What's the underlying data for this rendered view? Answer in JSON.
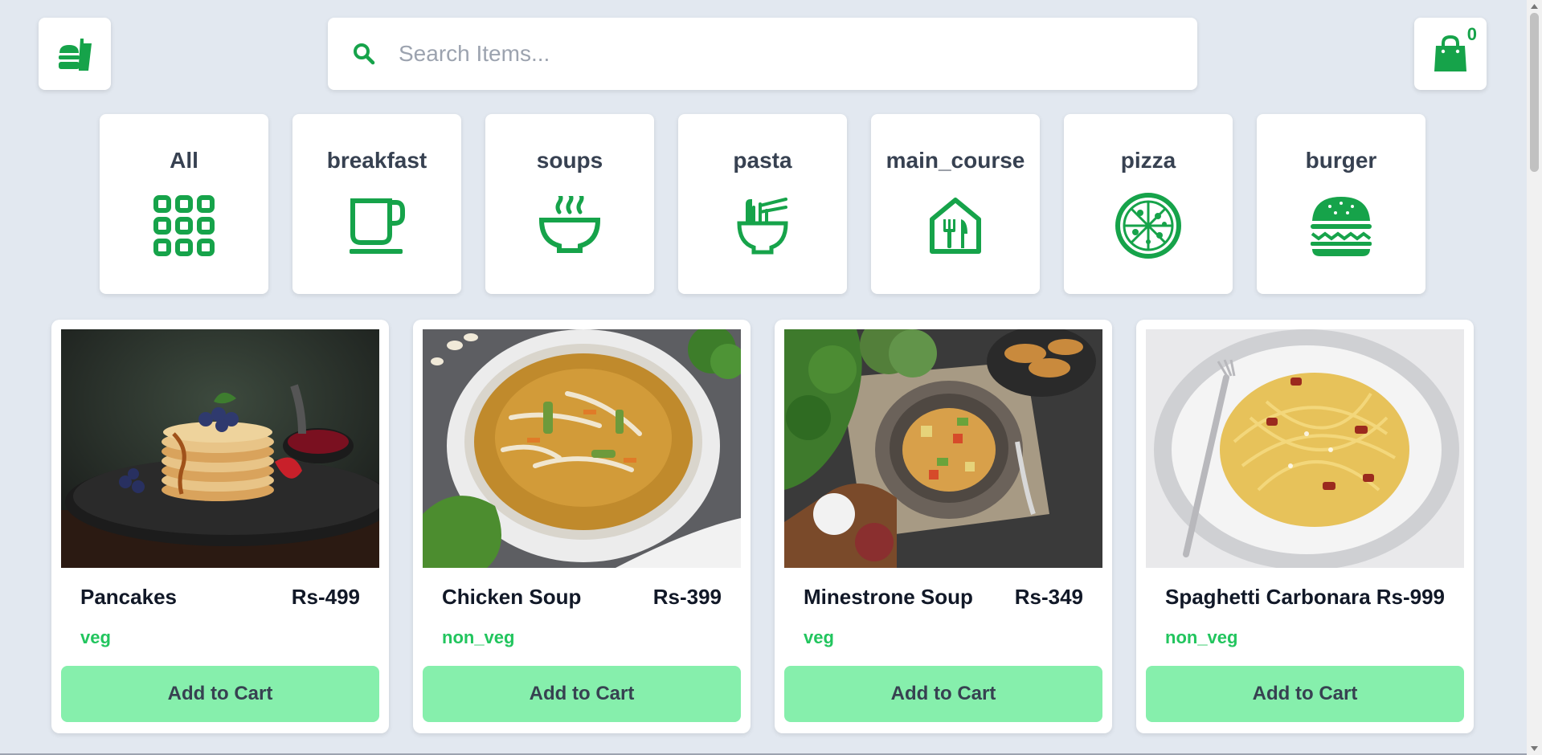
{
  "header": {
    "logo_icon": "fast-food-icon",
    "search": {
      "placeholder": "Search Items...",
      "value": "",
      "icon": "search-icon"
    },
    "cart": {
      "icon": "shopping-bag-icon",
      "count": "0"
    }
  },
  "categories": [
    {
      "label": "All",
      "icon": "grid-icon"
    },
    {
      "label": "breakfast",
      "icon": "coffee-cup-icon"
    },
    {
      "label": "soups",
      "icon": "soup-bowl-icon"
    },
    {
      "label": "pasta",
      "icon": "noodles-icon"
    },
    {
      "label": "main_course",
      "icon": "restaurant-icon"
    },
    {
      "label": "pizza",
      "icon": "pizza-icon"
    },
    {
      "label": "burger",
      "icon": "burger-icon"
    }
  ],
  "products": [
    {
      "name": "Pancakes",
      "price": "Rs-499",
      "type": "veg",
      "button": "Add to Cart",
      "image": "pancakes-photo"
    },
    {
      "name": "Chicken Soup",
      "price": "Rs-399",
      "type": "non_veg",
      "button": "Add to Cart",
      "image": "chicken-soup-photo"
    },
    {
      "name": "Minestrone Soup",
      "price": "Rs-349",
      "type": "veg",
      "button": "Add to Cart",
      "image": "minestrone-soup-photo"
    },
    {
      "name": "Spaghetti Carbonara",
      "price": "Rs-999",
      "type": "non_veg",
      "button": "Add to Cart",
      "image": "spaghetti-photo"
    }
  ],
  "colors": {
    "background": "#e2e8f0",
    "accent": "#16a34a",
    "button": "#86efac",
    "type_text": "#22c55e"
  }
}
